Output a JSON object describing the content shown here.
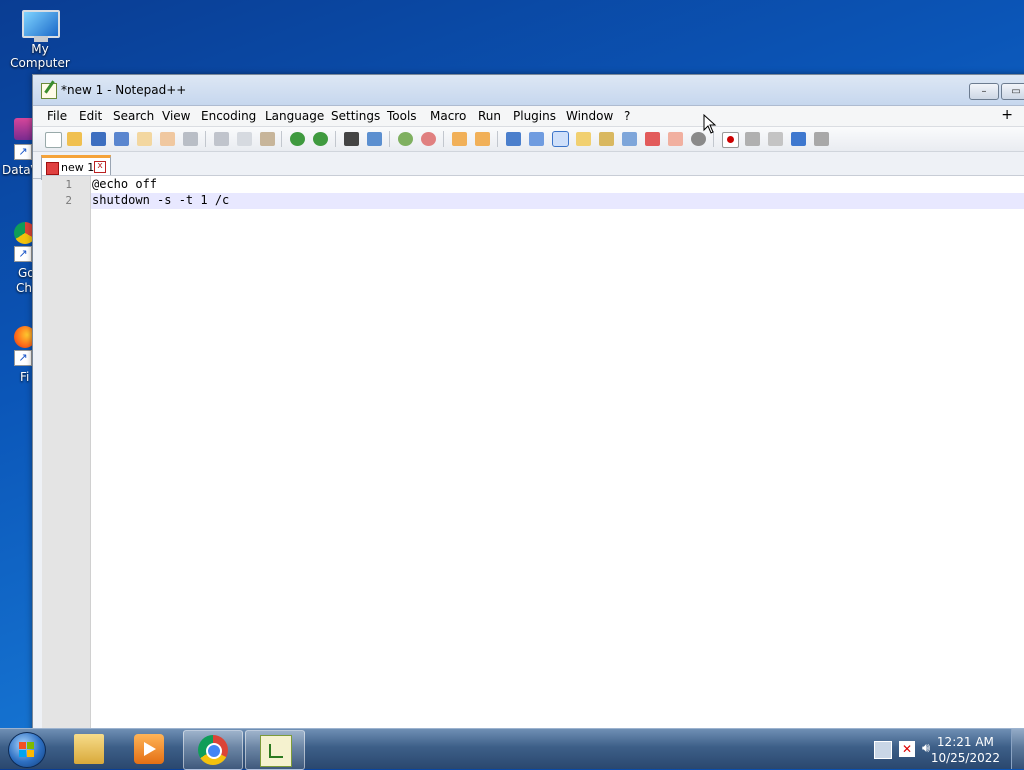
{
  "desktop": {
    "icons": [
      {
        "label": "My Computer"
      },
      {
        "label": "DataV"
      },
      {
        "label": "Go"
      },
      {
        "label": "Ch"
      },
      {
        "label": "Fi"
      }
    ]
  },
  "window": {
    "title": "*new 1 - Notepad++",
    "buttons": {
      "minimize": "–",
      "maximize": "▭"
    }
  },
  "menubar": {
    "items": [
      "File",
      "Edit",
      "Search",
      "View",
      "Encoding",
      "Language",
      "Settings",
      "Tools",
      "Macro",
      "Run",
      "Plugins",
      "Window",
      "?"
    ],
    "plus": "+"
  },
  "toolbar": {
    "icons": [
      "new-file-icon",
      "open-file-icon",
      "save-icon",
      "save-all-icon",
      "close-icon",
      "close-all-icon",
      "print-icon",
      "cut-icon",
      "copy-icon",
      "paste-icon",
      "undo-icon",
      "redo-icon",
      "find-icon",
      "replace-icon",
      "zoom-in-icon",
      "zoom-out-icon",
      "sync-vertical-icon",
      "sync-horizontal-icon",
      "word-wrap-icon",
      "show-all-chars-icon",
      "indent-guide-icon",
      "user-language-icon",
      "doc-map-icon",
      "document-list-icon",
      "function-list-icon",
      "folder-workspace-icon",
      "monitoring-icon",
      "record-macro-icon",
      "stop-record-icon",
      "play-macro-icon",
      "run-macro-multiple-icon",
      "save-macro-icon"
    ]
  },
  "tabs": [
    {
      "label": "new 1",
      "close": "x"
    }
  ],
  "editor": {
    "lines": [
      {
        "number": "1",
        "text": "@echo off"
      },
      {
        "number": "2",
        "text": "shutdown -s -t 1 /c"
      }
    ]
  },
  "taskbar": {
    "clock_time": "12:21 AM",
    "clock_date": "10/25/2022"
  }
}
